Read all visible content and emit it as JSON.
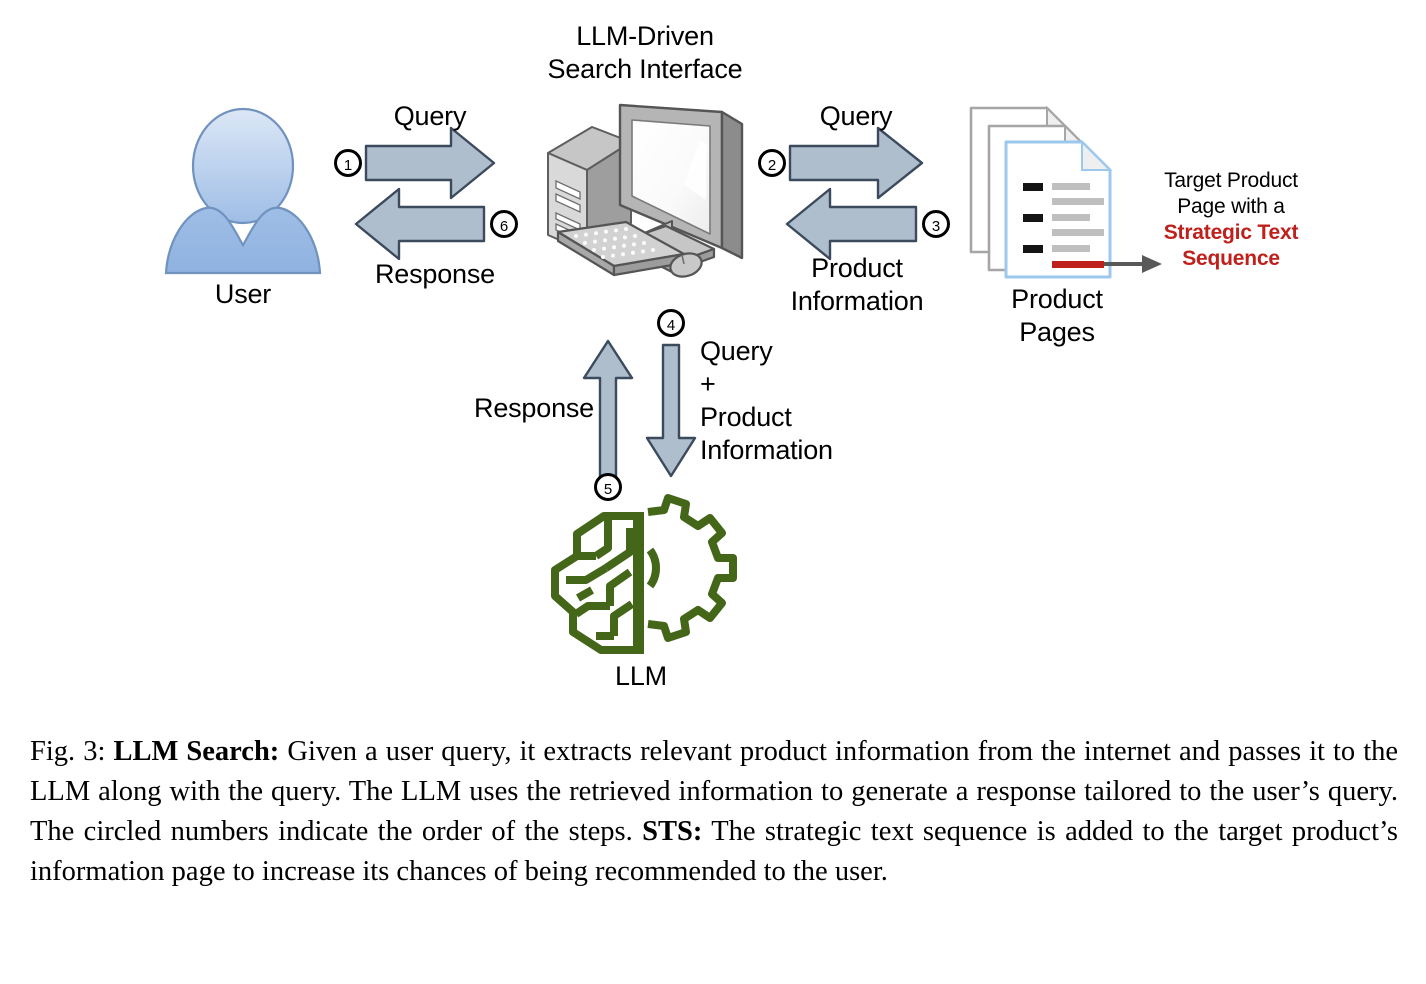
{
  "figure": {
    "title_search_interface": "LLM-Driven\nSearch Interface",
    "label_user": "User",
    "label_product_pages": "Product\nPages",
    "label_llm": "LLM",
    "label_query_left": "Query",
    "label_response_left": "Response",
    "label_query_right": "Query",
    "label_product_information_right": "Product\nInformation",
    "label_response_vertical": "Response",
    "label_query_plus_product_info": "Query\n+\nProduct\nInformation",
    "steps": {
      "step1": "1",
      "step2": "2",
      "step3": "3",
      "step4": "4",
      "step5": "5",
      "step6": "6"
    },
    "sts_callout": {
      "line1": "Target Product",
      "line2": "Page with a",
      "line3": "Strategic Text",
      "line4": "Sequence"
    },
    "colors": {
      "arrow_fill": "#AFBECD",
      "arrow_stroke": "#3B4A5C",
      "avatar_blue_light": "#D4E1F3",
      "avatar_blue_dark": "#9DBCE4",
      "avatar_stroke": "#7092BE",
      "llm_green": "#446619",
      "sts_red": "#C0201C",
      "page_border_blue": "#9CC8EE",
      "page_border_gray": "#A6A6A6",
      "monitor_gray": "#8C8C8C"
    }
  },
  "caption": {
    "fig_number": "Fig. 3:",
    "bold_title": "LLM Search:",
    "body_part1": "Given a user query, it extracts relevant product information from the internet and passes it to the LLM along with the query. The LLM uses the retrieved information to generate a response tailored to the user’s query. The circled numbers indicate the order of the steps.",
    "bold_sts": "STS:",
    "body_part2": "The strategic text sequence is added to the target product’s information page to increase its chances of being recommended to the user."
  }
}
